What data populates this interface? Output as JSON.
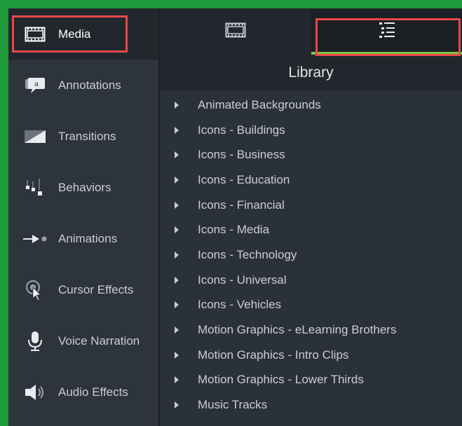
{
  "sidebar": {
    "items": [
      {
        "label": "Media",
        "icon": "film-icon",
        "active": true
      },
      {
        "label": "Annotations",
        "icon": "annotation-icon"
      },
      {
        "label": "Transitions",
        "icon": "transition-icon"
      },
      {
        "label": "Behaviors",
        "icon": "behaviors-icon"
      },
      {
        "label": "Animations",
        "icon": "animation-arrow-icon"
      },
      {
        "label": "Cursor Effects",
        "icon": "cursor-effect-icon"
      },
      {
        "label": "Voice Narration",
        "icon": "microphone-icon"
      },
      {
        "label": "Audio Effects",
        "icon": "speaker-icon"
      }
    ]
  },
  "tabs": [
    {
      "name": "media-bin",
      "icon": "film-icon",
      "active": false
    },
    {
      "name": "library",
      "icon": "list-icon",
      "active": true
    }
  ],
  "library": {
    "title": "Library",
    "items": [
      "Animated Backgrounds",
      "Icons - Buildings",
      "Icons - Business",
      "Icons - Education",
      "Icons - Financial",
      "Icons - Media",
      "Icons - Technology",
      "Icons - Universal",
      "Icons - Vehicles",
      "Motion Graphics - eLearning Brothers",
      "Motion Graphics - Intro Clips",
      "Motion Graphics - Lower Thirds",
      "Music Tracks"
    ]
  },
  "colors": {
    "accent": "#7ac943",
    "highlight": "#e8474a",
    "border": "#1e9a3a"
  }
}
